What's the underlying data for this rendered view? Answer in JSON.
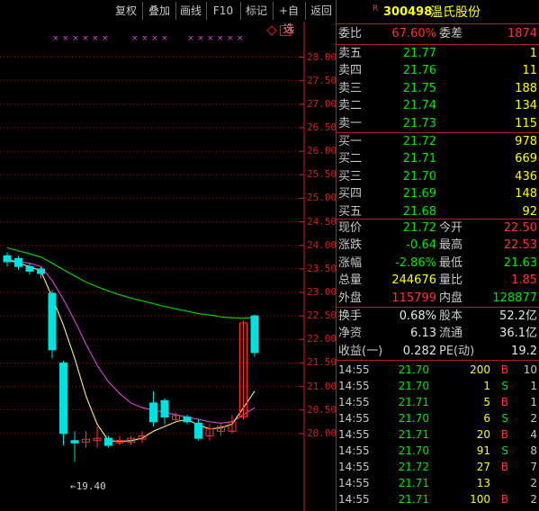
{
  "toolbar": {
    "buttons": [
      "复权",
      "叠加",
      "画线",
      "F10",
      "标记",
      "+自选",
      "返回"
    ]
  },
  "stock": {
    "code": "300498",
    "name": "温氏股份",
    "tag": "R"
  },
  "order_ratio": {
    "label1": "委比",
    "value1": "67.60%",
    "label2": "委差",
    "value2": "1874"
  },
  "asks": [
    {
      "label": "卖五",
      "price": "21.77",
      "volume": "1"
    },
    {
      "label": "卖四",
      "price": "21.76",
      "volume": "11"
    },
    {
      "label": "卖三",
      "price": "21.75",
      "volume": "188"
    },
    {
      "label": "卖二",
      "price": "21.74",
      "volume": "134"
    },
    {
      "label": "卖一",
      "price": "21.73",
      "volume": "115"
    }
  ],
  "bids": [
    {
      "label": "买一",
      "price": "21.72",
      "volume": "978"
    },
    {
      "label": "买二",
      "price": "21.71",
      "volume": "669"
    },
    {
      "label": "买三",
      "price": "21.70",
      "volume": "436"
    },
    {
      "label": "买四",
      "price": "21.69",
      "volume": "148"
    },
    {
      "label": "买五",
      "price": "21.68",
      "volume": "92"
    }
  ],
  "quote": [
    {
      "l1": "现价",
      "v1": "21.72",
      "l2": "今开",
      "v2": "22.50"
    },
    {
      "l1": "涨跌",
      "v1": "-0.64",
      "l2": "最高",
      "v2": "22.53"
    },
    {
      "l1": "涨幅",
      "v1": "-2.86%",
      "l2": "最低",
      "v2": "21.63"
    },
    {
      "l1": "总量",
      "v1": "244676",
      "l2": "量比",
      "v2": "1.85"
    },
    {
      "l1": "外盘",
      "v1": "115799",
      "l2": "内盘",
      "v2": "128877"
    }
  ],
  "fundamentals": [
    {
      "l1": "换手",
      "v1": "0.68%",
      "l2": "股本",
      "v2": "52.2亿"
    },
    {
      "l1": "净资",
      "v1": "6.13",
      "l2": "流通",
      "v2": "36.1亿"
    },
    {
      "l1": "收益(一)",
      "v1": "0.282",
      "l2": "PE(动)",
      "v2": "19.2"
    }
  ],
  "trades": [
    {
      "time": "14:55",
      "price": "21.70",
      "volume": "200",
      "side": "B",
      "count": "10"
    },
    {
      "time": "14:55",
      "price": "21.70",
      "volume": "1",
      "side": "S",
      "count": "1"
    },
    {
      "time": "14:55",
      "price": "21.71",
      "volume": "5",
      "side": "B",
      "count": "1"
    },
    {
      "time": "14:55",
      "price": "21.70",
      "volume": "6",
      "side": "S",
      "count": "2"
    },
    {
      "time": "14:55",
      "price": "21.71",
      "volume": "20",
      "side": "B",
      "count": "4"
    },
    {
      "time": "14:55",
      "price": "21.70",
      "volume": "91",
      "side": "S",
      "count": "8"
    },
    {
      "time": "14:55",
      "price": "21.72",
      "volume": "27",
      "side": "B",
      "count": "7"
    },
    {
      "time": "14:55",
      "price": "21.71",
      "volume": "13",
      "side": "",
      "count": "2"
    },
    {
      "time": "14:55",
      "price": "21.71",
      "volume": "100",
      "side": "B",
      "count": "2"
    }
  ],
  "chart_data": {
    "type": "candlestick",
    "price_ticks": [
      "28.00",
      "27.50",
      "27.00",
      "26.50",
      "26.00",
      "25.50",
      "25.00",
      "24.50",
      "24.00",
      "23.50",
      "23.00",
      "22.50",
      "22.00",
      "21.50",
      "21.00",
      "20.50",
      "20.00"
    ],
    "ylim": [
      19.2,
      28.4
    ],
    "low_annotation": "19.40",
    "candles": [
      {
        "o": 23.78,
        "c": 23.65,
        "h": 23.85,
        "l": 23.55
      },
      {
        "o": 23.72,
        "c": 23.55,
        "h": 23.78,
        "l": 23.48
      },
      {
        "o": 23.55,
        "c": 23.45,
        "h": 23.62,
        "l": 23.38
      },
      {
        "o": 23.5,
        "c": 23.4,
        "h": 23.55,
        "l": 23.3
      },
      {
        "o": 22.98,
        "c": 21.78,
        "h": 23.05,
        "l": 21.6
      },
      {
        "o": 21.5,
        "c": 20.0,
        "h": 21.55,
        "l": 19.75
      },
      {
        "o": 19.85,
        "c": 19.8,
        "h": 20.05,
        "l": 19.4
      },
      {
        "o": 19.82,
        "c": 19.88,
        "h": 20.05,
        "l": 19.7
      },
      {
        "o": 19.85,
        "c": 19.9,
        "h": 20.15,
        "l": 19.7
      },
      {
        "o": 19.9,
        "c": 19.75,
        "h": 19.95,
        "l": 19.7
      },
      {
        "o": 19.8,
        "c": 19.85,
        "h": 19.95,
        "l": 19.75
      },
      {
        "o": 19.82,
        "c": 19.9,
        "h": 19.95,
        "l": 19.75
      },
      {
        "o": 19.88,
        "c": 19.95,
        "h": 20.05,
        "l": 19.8
      },
      {
        "o": 20.65,
        "c": 20.25,
        "h": 20.9,
        "l": 20.15
      },
      {
        "o": 20.7,
        "c": 20.35,
        "h": 20.75,
        "l": 20.2
      },
      {
        "o": 20.3,
        "c": 20.38,
        "h": 20.45,
        "l": 20.25
      },
      {
        "o": 20.35,
        "c": 20.25,
        "h": 20.4,
        "l": 20.2
      },
      {
        "o": 20.22,
        "c": 19.9,
        "h": 20.3,
        "l": 19.85
      },
      {
        "o": 19.95,
        "c": 20.1,
        "h": 20.2,
        "l": 19.85
      },
      {
        "o": 20.05,
        "c": 20.15,
        "h": 20.2,
        "l": 19.95
      },
      {
        "o": 20.05,
        "c": 20.25,
        "h": 20.4,
        "l": 20.0
      },
      {
        "o": 20.35,
        "c": 22.35,
        "h": 22.4,
        "l": 20.3
      },
      {
        "o": 22.5,
        "c": 21.72,
        "h": 22.53,
        "l": 21.63
      }
    ],
    "ma_short": [
      23.7,
      23.62,
      23.55,
      23.45,
      22.9,
      22.3,
      21.6,
      20.8,
      20.2,
      19.85,
      19.83,
      19.85,
      19.9,
      20.05,
      20.15,
      20.25,
      20.3,
      20.18,
      20.1,
      20.12,
      20.2,
      20.55,
      20.9
    ],
    "ma_mid": [
      23.7,
      23.65,
      23.62,
      23.55,
      23.25,
      22.85,
      22.4,
      21.9,
      21.45,
      21.1,
      20.85,
      20.65,
      20.55,
      20.5,
      20.45,
      20.4,
      20.35,
      20.3,
      20.25,
      20.22,
      20.25,
      20.4,
      20.55
    ],
    "ma_long": [
      23.95,
      23.88,
      23.82,
      23.75,
      23.62,
      23.48,
      23.35,
      23.22,
      23.12,
      23.03,
      22.95,
      22.88,
      22.82,
      22.76,
      22.7,
      22.65,
      22.6,
      22.55,
      22.52,
      22.48,
      22.46,
      22.45,
      22.47
    ]
  }
}
